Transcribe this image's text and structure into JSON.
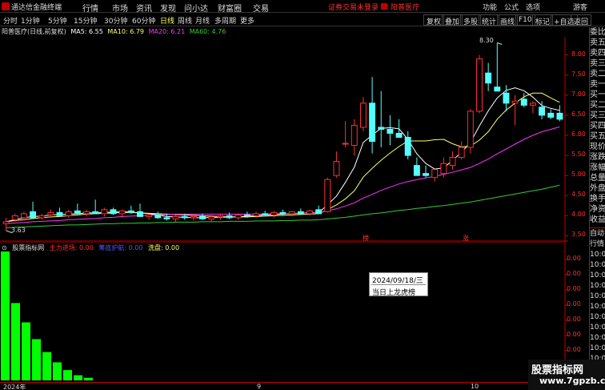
{
  "titlebar": {
    "app_title": "通达信金融终端",
    "menu": [
      "行情",
      "市场",
      "资讯",
      "发现",
      "问小达",
      "财富圈",
      "交易"
    ],
    "warning": "证券交易未登录",
    "stock_name": "阳普医疗",
    "right_menu": [
      "功能",
      "公式",
      "选项"
    ],
    "guest": "游客"
  },
  "toolbar": {
    "periods": [
      "分时",
      "1分钟",
      "5分钟",
      "15分钟",
      "30分钟",
      "60分钟",
      "日线",
      "周线",
      "月线",
      "多周期",
      "更多"
    ],
    "active_period": "日线",
    "right_buttons": [
      "复权",
      "叠加",
      "多股",
      "统计",
      "画线",
      "F10",
      "标记",
      "+自选",
      "返回"
    ]
  },
  "chart_header": {
    "title": "阳普医疗(日线,前复权)",
    "ma5": "MA5: 6.55",
    "ma10": "MA10: 6.79",
    "ma20": "MA20: 6.21",
    "ma60": "MA60: 4.76"
  },
  "indicator_header": {
    "name": "股票指标网",
    "main_in": "主力进场: 0.00",
    "protect": "筹底护航: 0.00",
    "wash": "洗盘: 0.00"
  },
  "markers": {
    "high_label": "8.30",
    "low_label": "3.63",
    "mark1": "榜",
    "mark2": "涨"
  },
  "tooltip": {
    "date": "2024/09/18/三",
    "text": "当日上龙虎榜"
  },
  "right_panel": [
    "委比",
    "卖五",
    "卖四",
    "卖三",
    "卖二",
    "卖一",
    "买一",
    "买二",
    "买三",
    "买四",
    "买五",
    "现价",
    "涨跌",
    "涨幅",
    "总量",
    "外盘",
    "换手",
    "净资",
    "收益"
  ],
  "right_panel2": [
    "自动",
    "行情",
    "10:0",
    "10:0",
    "10:0",
    "10:0",
    "10:0",
    "10:0",
    "10:0",
    "10:0",
    "10:0",
    "10:0",
    "10:0"
  ],
  "bottom_axis": [
    "2024年",
    "9",
    "10"
  ],
  "watermark": {
    "line1": "股票指标网",
    "line2": "www.7gpzb.com"
  },
  "colors": {
    "up": "#ff3030",
    "down": "#54ffff",
    "ma5": "#ffffff",
    "ma10": "#ffff66",
    "ma20": "#ff33ff",
    "ma60": "#33cc33",
    "volume_bar": "#00ff00"
  },
  "chart_data": {
    "type": "candlestick",
    "title": "阳普医疗(日线,前复权)",
    "y_ticks": [
      8.0,
      7.5,
      7.0,
      6.5,
      6.0,
      5.5,
      5.0,
      4.5,
      4.0,
      3.5
    ],
    "ylim": [
      3.35,
      8.45
    ],
    "candles": [
      {
        "o": 3.8,
        "h": 3.95,
        "l": 3.63,
        "c": 3.85
      },
      {
        "o": 3.9,
        "h": 4.05,
        "l": 3.85,
        "c": 4.0
      },
      {
        "o": 3.95,
        "h": 4.1,
        "l": 3.88,
        "c": 4.05
      },
      {
        "o": 4.1,
        "h": 4.35,
        "l": 4.0,
        "c": 3.95
      },
      {
        "o": 3.95,
        "h": 4.05,
        "l": 3.9,
        "c": 4.0
      },
      {
        "o": 4.02,
        "h": 4.15,
        "l": 3.95,
        "c": 4.08
      },
      {
        "o": 4.08,
        "h": 4.2,
        "l": 4.0,
        "c": 4.0
      },
      {
        "o": 4.0,
        "h": 4.15,
        "l": 3.95,
        "c": 4.1
      },
      {
        "o": 4.12,
        "h": 4.3,
        "l": 4.05,
        "c": 4.05
      },
      {
        "o": 4.05,
        "h": 4.15,
        "l": 3.98,
        "c": 4.1
      },
      {
        "o": 4.1,
        "h": 4.4,
        "l": 4.05,
        "c": 4.05
      },
      {
        "o": 4.05,
        "h": 4.2,
        "l": 3.98,
        "c": 4.15
      },
      {
        "o": 4.15,
        "h": 4.2,
        "l": 4.02,
        "c": 4.05
      },
      {
        "o": 4.05,
        "h": 4.15,
        "l": 3.95,
        "c": 4.12
      },
      {
        "o": 4.12,
        "h": 4.25,
        "l": 4.05,
        "c": 4.08
      },
      {
        "o": 4.1,
        "h": 4.3,
        "l": 4.0,
        "c": 3.98
      },
      {
        "o": 3.98,
        "h": 4.05,
        "l": 3.9,
        "c": 4.02
      },
      {
        "o": 4.02,
        "h": 4.1,
        "l": 3.92,
        "c": 3.95
      },
      {
        "o": 3.95,
        "h": 4.05,
        "l": 3.88,
        "c": 3.92
      },
      {
        "o": 3.92,
        "h": 4.02,
        "l": 3.85,
        "c": 3.98
      },
      {
        "o": 3.98,
        "h": 4.05,
        "l": 3.9,
        "c": 3.95
      },
      {
        "o": 3.95,
        "h": 4.02,
        "l": 3.88,
        "c": 3.98
      },
      {
        "o": 3.98,
        "h": 4.05,
        "l": 3.9,
        "c": 3.92
      },
      {
        "o": 3.92,
        "h": 4.02,
        "l": 3.85,
        "c": 3.97
      },
      {
        "o": 3.97,
        "h": 4.05,
        "l": 3.9,
        "c": 4.0
      },
      {
        "o": 4.0,
        "h": 4.08,
        "l": 3.92,
        "c": 3.95
      },
      {
        "o": 3.95,
        "h": 4.05,
        "l": 3.9,
        "c": 4.02
      },
      {
        "o": 4.02,
        "h": 4.1,
        "l": 3.95,
        "c": 4.0
      },
      {
        "o": 4.0,
        "h": 4.1,
        "l": 3.95,
        "c": 4.05
      },
      {
        "o": 4.05,
        "h": 4.12,
        "l": 3.98,
        "c": 4.02
      },
      {
        "o": 4.02,
        "h": 4.12,
        "l": 3.95,
        "c": 4.08
      },
      {
        "o": 4.08,
        "h": 4.15,
        "l": 4.0,
        "c": 4.05
      },
      {
        "o": 4.05,
        "h": 4.12,
        "l": 3.98,
        "c": 4.1
      },
      {
        "o": 4.1,
        "h": 4.18,
        "l": 4.02,
        "c": 4.05
      },
      {
        "o": 4.05,
        "h": 4.15,
        "l": 4.0,
        "c": 4.12
      },
      {
        "o": 4.15,
        "h": 4.25,
        "l": 4.05,
        "c": 4.05
      },
      {
        "o": 4.1,
        "h": 4.95,
        "l": 4.08,
        "c": 4.9
      },
      {
        "o": 5.0,
        "h": 5.6,
        "l": 4.95,
        "c": 5.35
      },
      {
        "o": 5.8,
        "h": 6.35,
        "l": 5.7,
        "c": 5.8
      },
      {
        "o": 5.75,
        "h": 6.4,
        "l": 5.5,
        "c": 6.25
      },
      {
        "o": 6.2,
        "h": 6.95,
        "l": 6.1,
        "c": 6.8
      },
      {
        "o": 6.8,
        "h": 7.45,
        "l": 5.55,
        "c": 5.85
      },
      {
        "o": 6.2,
        "h": 7.1,
        "l": 5.7,
        "c": 6.15
      },
      {
        "o": 6.15,
        "h": 6.5,
        "l": 5.75,
        "c": 6.05
      },
      {
        "o": 6.05,
        "h": 6.4,
        "l": 5.95,
        "c": 5.95
      },
      {
        "o": 5.95,
        "h": 6.1,
        "l": 5.4,
        "c": 5.5
      },
      {
        "o": 5.25,
        "h": 5.45,
        "l": 5.0,
        "c": 5.0
      },
      {
        "o": 5.05,
        "h": 5.25,
        "l": 4.95,
        "c": 5.0
      },
      {
        "o": 4.95,
        "h": 5.15,
        "l": 4.85,
        "c": 5.15
      },
      {
        "o": 5.05,
        "h": 5.45,
        "l": 4.95,
        "c": 5.3
      },
      {
        "o": 5.25,
        "h": 5.6,
        "l": 5.15,
        "c": 5.45
      },
      {
        "o": 5.45,
        "h": 5.85,
        "l": 5.4,
        "c": 5.7
      },
      {
        "o": 5.7,
        "h": 6.65,
        "l": 5.55,
        "c": 6.6
      },
      {
        "o": 6.6,
        "h": 8.0,
        "l": 6.55,
        "c": 7.9
      },
      {
        "o": 7.55,
        "h": 7.8,
        "l": 7.1,
        "c": 7.3
      },
      {
        "o": 7.2,
        "h": 8.3,
        "l": 7.1,
        "c": 7.1
      },
      {
        "o": 7.05,
        "h": 7.25,
        "l": 6.6,
        "c": 6.8
      },
      {
        "o": 6.8,
        "h": 7.0,
        "l": 6.25,
        "c": 6.85
      },
      {
        "o": 6.9,
        "h": 7.05,
        "l": 6.7,
        "c": 6.75
      },
      {
        "o": 6.75,
        "h": 6.85,
        "l": 6.55,
        "c": 6.8
      },
      {
        "o": 6.7,
        "h": 6.85,
        "l": 6.4,
        "c": 6.5
      },
      {
        "o": 6.55,
        "h": 6.65,
        "l": 6.4,
        "c": 6.45
      },
      {
        "o": 6.55,
        "h": 6.75,
        "l": 6.35,
        "c": 6.4
      }
    ],
    "ma": {
      "ma5": [
        3.85,
        3.9,
        3.95,
        3.98,
        3.99,
        4.02,
        4.03,
        4.04,
        4.05,
        4.07,
        4.07,
        4.08,
        4.09,
        4.1,
        4.09,
        4.07,
        4.05,
        4.02,
        3.98,
        3.97,
        3.96,
        3.95,
        3.95,
        3.96,
        3.96,
        3.97,
        3.97,
        3.99,
        4.0,
        4.02,
        4.03,
        4.04,
        4.06,
        4.06,
        4.08,
        4.07,
        4.27,
        4.49,
        4.83,
        5.21,
        5.82,
        6.01,
        6.17,
        6.19,
        6.16,
        5.9,
        5.54,
        5.3,
        5.16,
        5.19,
        5.38,
        5.58,
        5.82,
        6.23,
        6.61,
        6.93,
        7.12,
        7.18,
        7.11,
        6.95,
        6.74,
        6.67,
        6.62
      ],
      "ma10": [
        3.85,
        3.88,
        3.9,
        3.93,
        3.95,
        3.97,
        3.98,
        4.0,
        4.02,
        4.04,
        4.05,
        4.06,
        4.07,
        4.08,
        4.08,
        4.07,
        4.06,
        4.05,
        4.04,
        4.03,
        4.02,
        4.01,
        4.0,
        3.99,
        3.98,
        3.97,
        3.97,
        3.97,
        3.98,
        3.99,
        4.0,
        4.01,
        4.02,
        4.03,
        4.04,
        4.05,
        4.15,
        4.27,
        4.42,
        4.62,
        4.96,
        5.18,
        5.38,
        5.56,
        5.72,
        5.86,
        5.86,
        5.86,
        5.89,
        5.9,
        5.79,
        5.71,
        5.73,
        5.88,
        6.09,
        6.4,
        6.63,
        6.8,
        6.96,
        7.05,
        7.05,
        6.93,
        6.82
      ],
      "ma20": [
        3.8,
        3.82,
        3.83,
        3.85,
        3.86,
        3.87,
        3.88,
        3.9,
        3.91,
        3.92,
        3.93,
        3.95,
        3.96,
        3.98,
        3.99,
        4.0,
        4.01,
        4.02,
        4.03,
        4.04,
        4.04,
        4.04,
        4.04,
        4.04,
        4.04,
        4.04,
        4.04,
        4.04,
        4.04,
        4.04,
        4.05,
        4.05,
        4.05,
        4.06,
        4.07,
        4.08,
        4.12,
        4.17,
        4.24,
        4.32,
        4.44,
        4.53,
        4.63,
        4.71,
        4.79,
        4.85,
        4.9,
        4.94,
        4.98,
        5.03,
        5.08,
        5.14,
        5.2,
        5.3,
        5.41,
        5.54,
        5.66,
        5.78,
        5.9,
        6.0,
        6.09,
        6.15,
        6.21
      ],
      "ma60": [
        3.7,
        3.71,
        3.72,
        3.73,
        3.74,
        3.75,
        3.76,
        3.77,
        3.77,
        3.78,
        3.79,
        3.8,
        3.8,
        3.81,
        3.81,
        3.82,
        3.82,
        3.83,
        3.83,
        3.84,
        3.84,
        3.84,
        3.85,
        3.85,
        3.85,
        3.86,
        3.86,
        3.86,
        3.87,
        3.87,
        3.87,
        3.88,
        3.88,
        3.89,
        3.89,
        3.9,
        3.92,
        3.94,
        3.96,
        3.99,
        4.02,
        4.05,
        4.07,
        4.1,
        4.13,
        4.15,
        4.18,
        4.2,
        4.23,
        4.25,
        4.28,
        4.31,
        4.34,
        4.38,
        4.42,
        4.46,
        4.5,
        4.54,
        4.58,
        4.62,
        4.66,
        4.71,
        4.76
      ]
    },
    "indicator": {
      "y_ticks": [
        "0.00",
        "0.00",
        "0.00",
        "0.00",
        "0.00",
        "0.00",
        "0.00",
        "0.00"
      ],
      "wash_bars": [
        1.0,
        0.6,
        0.45,
        0.32,
        0.22,
        0.14,
        0.08,
        0.04,
        0.02
      ]
    }
  }
}
